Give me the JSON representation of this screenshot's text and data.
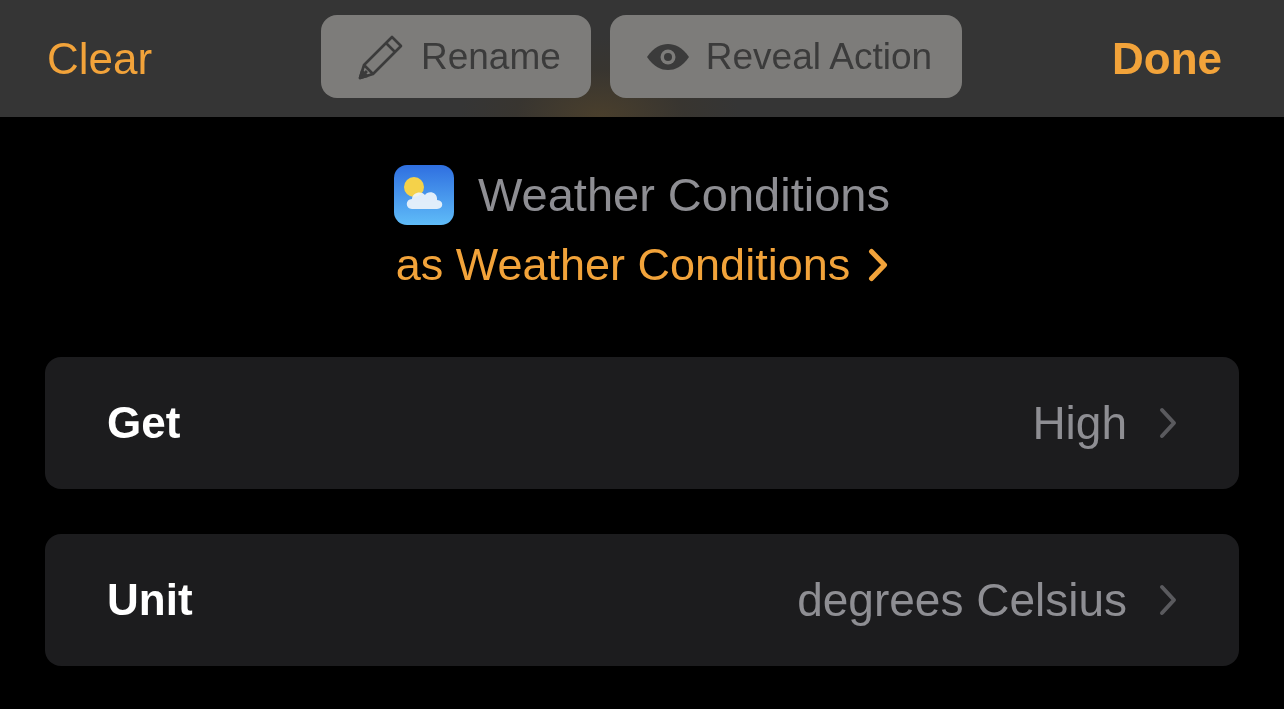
{
  "toolbar": {
    "left_button": "Clear",
    "actions": [
      {
        "kind": "rename",
        "label": "Rename"
      },
      {
        "kind": "reveal",
        "label": "Reveal Action"
      }
    ],
    "right_button": "Done"
  },
  "action": {
    "title": "Weather Conditions",
    "output": "as Weather Conditions"
  },
  "parameters": [
    {
      "label": "Get",
      "value": "High"
    },
    {
      "label": "Unit",
      "value": "degrees Celsius"
    }
  ]
}
